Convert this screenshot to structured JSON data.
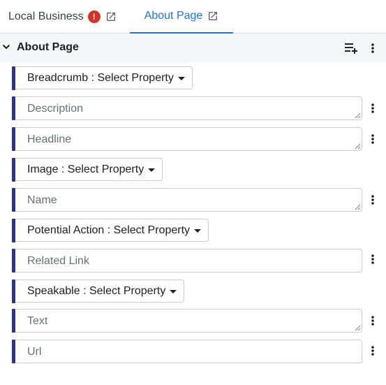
{
  "tabs": [
    {
      "label": "Local Business",
      "error_badge": "!"
    },
    {
      "label": "About Page"
    }
  ],
  "section": {
    "title": "About Page"
  },
  "rows": [
    {
      "type": "select",
      "label": "Breadcrumb : Select Property"
    },
    {
      "type": "textarea",
      "placeholder": "Description"
    },
    {
      "type": "textarea",
      "placeholder": "Headline"
    },
    {
      "type": "select",
      "label": "Image : Select Property"
    },
    {
      "type": "textarea",
      "placeholder": "Name"
    },
    {
      "type": "select",
      "label": "Potential Action : Select Property"
    },
    {
      "type": "input",
      "placeholder": "Related Link"
    },
    {
      "type": "select",
      "label": "Speakable : Select Property"
    },
    {
      "type": "textarea",
      "placeholder": "Text"
    },
    {
      "type": "input",
      "placeholder": "Url"
    }
  ],
  "colors": {
    "accent": "#27329a",
    "tab_active": "#1a73e8",
    "error": "#d93025",
    "header_bg": "#f6f7f9"
  },
  "icons": [
    "open-in-new-icon",
    "error-icon",
    "chevron-down-icon",
    "playlist-add-icon",
    "more-vert-icon",
    "resize-grip-icon",
    "dropdown-caret-icon"
  ]
}
